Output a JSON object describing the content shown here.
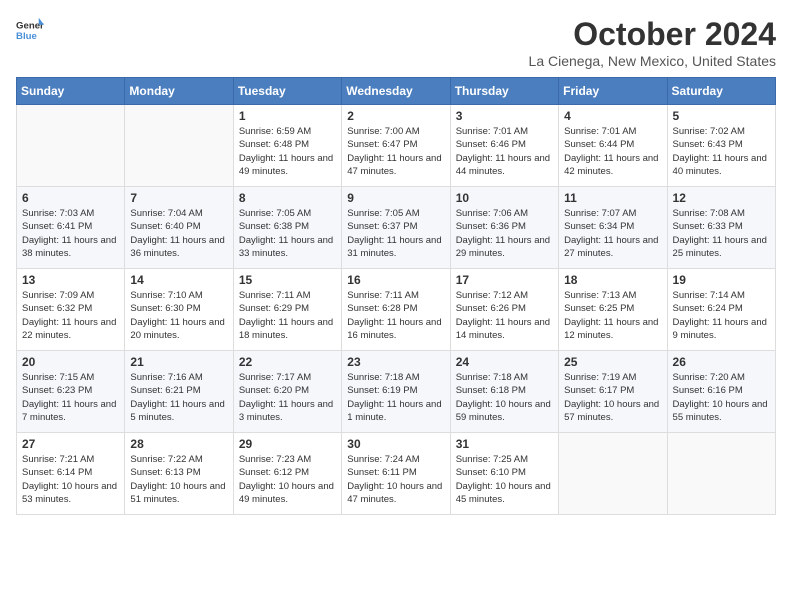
{
  "header": {
    "logo_line1": "General",
    "logo_line2": "Blue",
    "month_title": "October 2024",
    "location": "La Cienega, New Mexico, United States"
  },
  "weekdays": [
    "Sunday",
    "Monday",
    "Tuesday",
    "Wednesday",
    "Thursday",
    "Friday",
    "Saturday"
  ],
  "weeks": [
    [
      {
        "day": "",
        "info": ""
      },
      {
        "day": "",
        "info": ""
      },
      {
        "day": "1",
        "info": "Sunrise: 6:59 AM\nSunset: 6:48 PM\nDaylight: 11 hours and 49 minutes."
      },
      {
        "day": "2",
        "info": "Sunrise: 7:00 AM\nSunset: 6:47 PM\nDaylight: 11 hours and 47 minutes."
      },
      {
        "day": "3",
        "info": "Sunrise: 7:01 AM\nSunset: 6:46 PM\nDaylight: 11 hours and 44 minutes."
      },
      {
        "day": "4",
        "info": "Sunrise: 7:01 AM\nSunset: 6:44 PM\nDaylight: 11 hours and 42 minutes."
      },
      {
        "day": "5",
        "info": "Sunrise: 7:02 AM\nSunset: 6:43 PM\nDaylight: 11 hours and 40 minutes."
      }
    ],
    [
      {
        "day": "6",
        "info": "Sunrise: 7:03 AM\nSunset: 6:41 PM\nDaylight: 11 hours and 38 minutes."
      },
      {
        "day": "7",
        "info": "Sunrise: 7:04 AM\nSunset: 6:40 PM\nDaylight: 11 hours and 36 minutes."
      },
      {
        "day": "8",
        "info": "Sunrise: 7:05 AM\nSunset: 6:38 PM\nDaylight: 11 hours and 33 minutes."
      },
      {
        "day": "9",
        "info": "Sunrise: 7:05 AM\nSunset: 6:37 PM\nDaylight: 11 hours and 31 minutes."
      },
      {
        "day": "10",
        "info": "Sunrise: 7:06 AM\nSunset: 6:36 PM\nDaylight: 11 hours and 29 minutes."
      },
      {
        "day": "11",
        "info": "Sunrise: 7:07 AM\nSunset: 6:34 PM\nDaylight: 11 hours and 27 minutes."
      },
      {
        "day": "12",
        "info": "Sunrise: 7:08 AM\nSunset: 6:33 PM\nDaylight: 11 hours and 25 minutes."
      }
    ],
    [
      {
        "day": "13",
        "info": "Sunrise: 7:09 AM\nSunset: 6:32 PM\nDaylight: 11 hours and 22 minutes."
      },
      {
        "day": "14",
        "info": "Sunrise: 7:10 AM\nSunset: 6:30 PM\nDaylight: 11 hours and 20 minutes."
      },
      {
        "day": "15",
        "info": "Sunrise: 7:11 AM\nSunset: 6:29 PM\nDaylight: 11 hours and 18 minutes."
      },
      {
        "day": "16",
        "info": "Sunrise: 7:11 AM\nSunset: 6:28 PM\nDaylight: 11 hours and 16 minutes."
      },
      {
        "day": "17",
        "info": "Sunrise: 7:12 AM\nSunset: 6:26 PM\nDaylight: 11 hours and 14 minutes."
      },
      {
        "day": "18",
        "info": "Sunrise: 7:13 AM\nSunset: 6:25 PM\nDaylight: 11 hours and 12 minutes."
      },
      {
        "day": "19",
        "info": "Sunrise: 7:14 AM\nSunset: 6:24 PM\nDaylight: 11 hours and 9 minutes."
      }
    ],
    [
      {
        "day": "20",
        "info": "Sunrise: 7:15 AM\nSunset: 6:23 PM\nDaylight: 11 hours and 7 minutes."
      },
      {
        "day": "21",
        "info": "Sunrise: 7:16 AM\nSunset: 6:21 PM\nDaylight: 11 hours and 5 minutes."
      },
      {
        "day": "22",
        "info": "Sunrise: 7:17 AM\nSunset: 6:20 PM\nDaylight: 11 hours and 3 minutes."
      },
      {
        "day": "23",
        "info": "Sunrise: 7:18 AM\nSunset: 6:19 PM\nDaylight: 11 hours and 1 minute."
      },
      {
        "day": "24",
        "info": "Sunrise: 7:18 AM\nSunset: 6:18 PM\nDaylight: 10 hours and 59 minutes."
      },
      {
        "day": "25",
        "info": "Sunrise: 7:19 AM\nSunset: 6:17 PM\nDaylight: 10 hours and 57 minutes."
      },
      {
        "day": "26",
        "info": "Sunrise: 7:20 AM\nSunset: 6:16 PM\nDaylight: 10 hours and 55 minutes."
      }
    ],
    [
      {
        "day": "27",
        "info": "Sunrise: 7:21 AM\nSunset: 6:14 PM\nDaylight: 10 hours and 53 minutes."
      },
      {
        "day": "28",
        "info": "Sunrise: 7:22 AM\nSunset: 6:13 PM\nDaylight: 10 hours and 51 minutes."
      },
      {
        "day": "29",
        "info": "Sunrise: 7:23 AM\nSunset: 6:12 PM\nDaylight: 10 hours and 49 minutes."
      },
      {
        "day": "30",
        "info": "Sunrise: 7:24 AM\nSunset: 6:11 PM\nDaylight: 10 hours and 47 minutes."
      },
      {
        "day": "31",
        "info": "Sunrise: 7:25 AM\nSunset: 6:10 PM\nDaylight: 10 hours and 45 minutes."
      },
      {
        "day": "",
        "info": ""
      },
      {
        "day": "",
        "info": ""
      }
    ]
  ]
}
